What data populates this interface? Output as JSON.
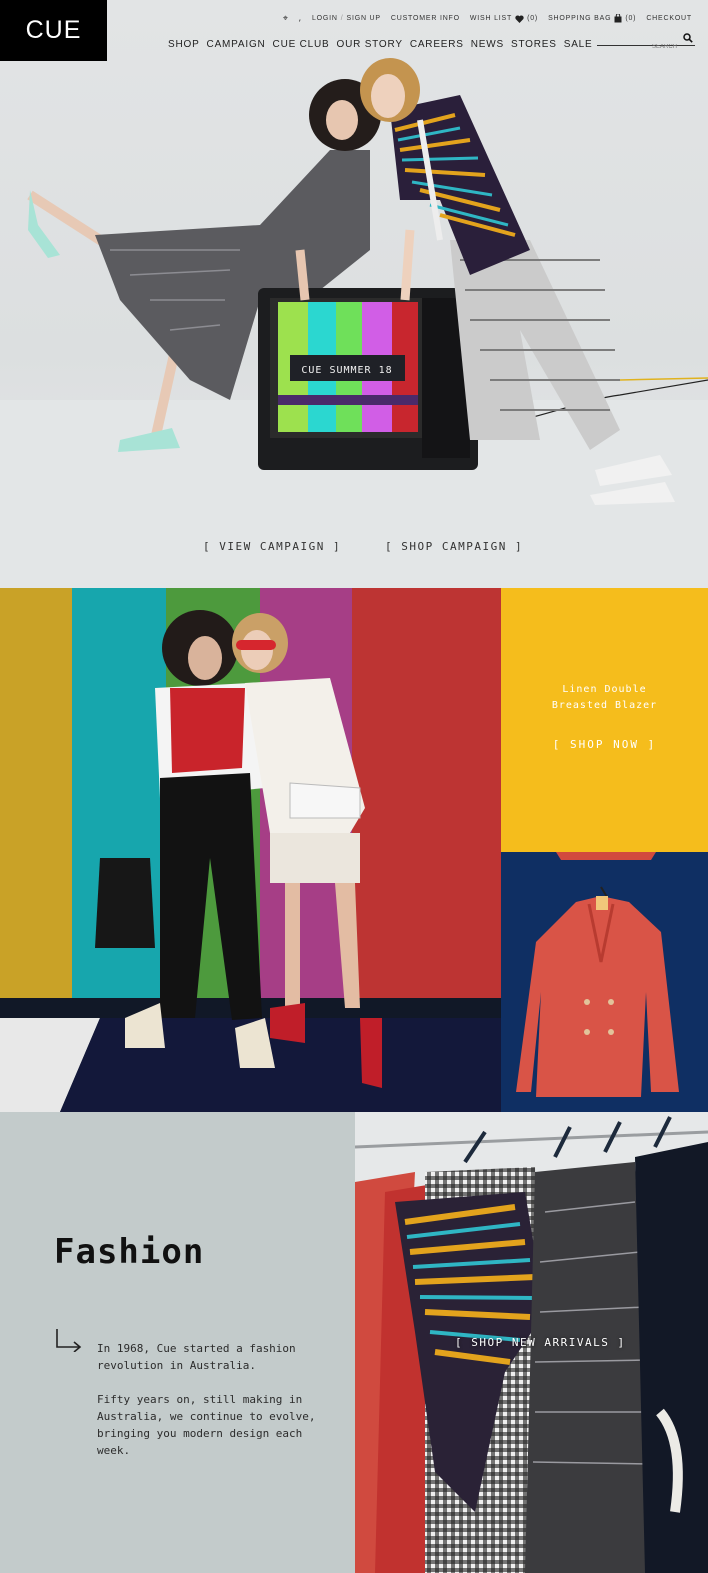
{
  "brand": {
    "logo_text": "CUE"
  },
  "utility": {
    "login": "LOGIN",
    "signup": "SIGN UP",
    "customer_info": "CUSTOMER INFO",
    "wish_list": "WISH LIST",
    "wish_count": "(0)",
    "shopping_bag": "SHOPPING BAG",
    "bag_count": "(0)",
    "checkout": "CHECKOUT",
    "separator": "/"
  },
  "nav": {
    "items": [
      "SHOP",
      "CAMPAIGN",
      "CUE CLUB",
      "OUR STORY",
      "CAREERS",
      "NEWS",
      "STORES",
      "SALE"
    ]
  },
  "search": {
    "placeholder": "SEARCH"
  },
  "hero": {
    "tv_text": "CUE SUMMER 18",
    "view_campaign": "[ VIEW CAMPAIGN ]",
    "shop_campaign": "[ SHOP CAMPAIGN ]"
  },
  "promo": {
    "title_line1": "Linen Double",
    "title_line2": "Breasted Blazer",
    "cta": "[ SHOP NOW ]"
  },
  "fashion": {
    "title": "Fashion",
    "para1": "In 1968, Cue started a fashion revolution in Australia.",
    "para2": "Fifty years on, still making in Australia, we continue to evolve, bringing you modern design each week.",
    "cta": "[ SHOP NEW ARRIVALS ]"
  },
  "colors": {
    "logo_bg": "#000000",
    "promo_yellow": "#f5bd1c",
    "blazer_bg": "#0f2f63",
    "fashion_panel": "#c3cbcb",
    "stripe_mustard": "#c9a227",
    "stripe_teal": "#17a6ad",
    "stripe_green": "#4d9a3d",
    "stripe_magenta": "#a63e86",
    "stripe_red": "#bd3433"
  }
}
